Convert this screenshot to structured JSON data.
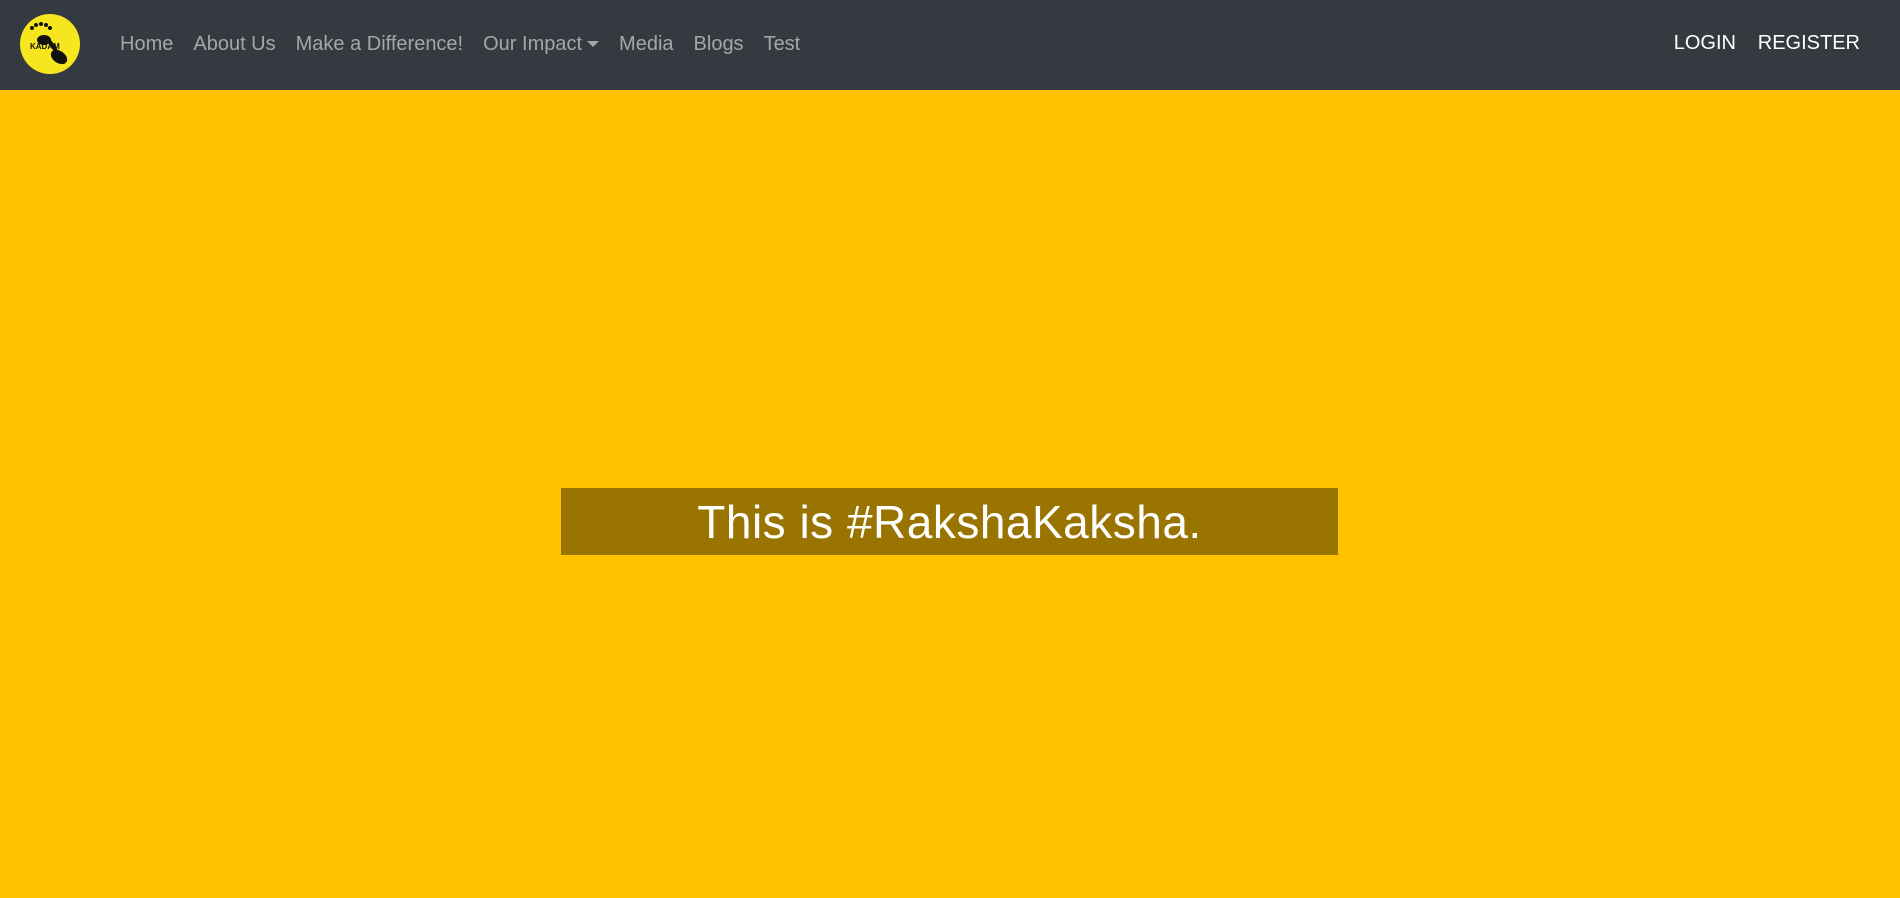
{
  "brand": {
    "logo_text": "KADAM",
    "logo_icon": "footprint-icon",
    "logo_color": "#f5e61f"
  },
  "nav": {
    "items": [
      {
        "label": "Home"
      },
      {
        "label": "About Us"
      },
      {
        "label": "Make a Difference!"
      },
      {
        "label": "Our Impact",
        "has_dropdown": true
      },
      {
        "label": "Media"
      },
      {
        "label": "Blogs"
      },
      {
        "label": "Test"
      }
    ],
    "login_label": "LOGIN",
    "register_label": "REGISTER"
  },
  "hero": {
    "headline": "This is #RakshaKaksha."
  },
  "colors": {
    "navbar_bg": "#343a40",
    "page_bg": "#ffc100",
    "banner_bg": "#9a7400",
    "nav_text": "#a3a7ab",
    "auth_text": "#ffffff"
  }
}
